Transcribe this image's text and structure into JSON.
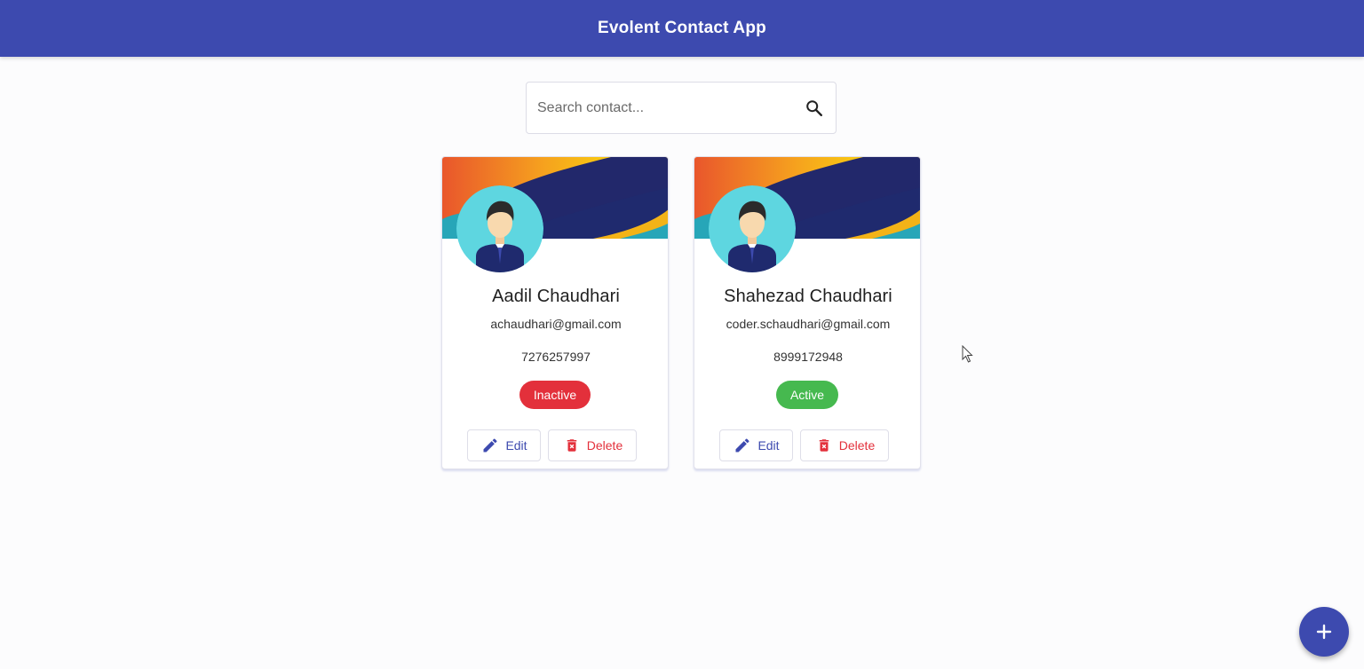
{
  "app": {
    "title": "Evolent Contact App"
  },
  "search": {
    "placeholder": "Search contact...",
    "value": ""
  },
  "contacts": [
    {
      "name": "Aadil Chaudhari",
      "email": "achaudhari@gmail.com",
      "phone": "7276257997",
      "status": "Inactive",
      "status_color": "#e3303b"
    },
    {
      "name": "Shahezad Chaudhari",
      "email": "coder.schaudhari@gmail.com",
      "phone": "8999172948",
      "status": "Active",
      "status_color": "#46b94f"
    }
  ],
  "actions": {
    "edit_label": "Edit",
    "delete_label": "Delete"
  },
  "icons": {
    "search": "search-icon",
    "edit": "pencil-icon",
    "delete": "trash-icon",
    "add": "plus-icon",
    "cursor": "mouse-pointer-icon"
  },
  "colors": {
    "primary": "#3d4aaf",
    "danger": "#e3303b",
    "success": "#46b94f"
  }
}
